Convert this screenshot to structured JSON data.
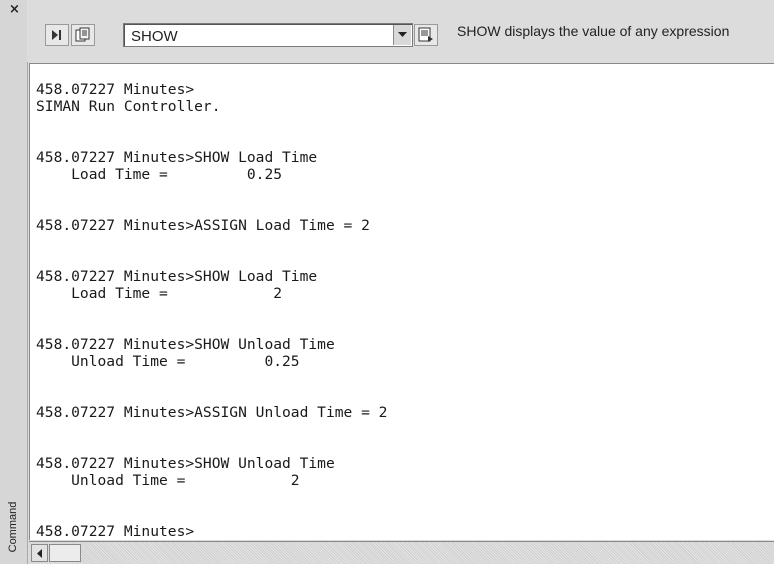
{
  "panel": {
    "title": "Command"
  },
  "toolbar": {
    "combo_value": "SHOW",
    "hint": "SHOW displays the value of any expression"
  },
  "console": {
    "lines": [
      "458.07227 Minutes>",
      "SIMAN Run Controller.",
      "",
      "",
      "458.07227 Minutes>SHOW Load Time",
      "    Load Time =         0.25",
      "",
      "",
      "458.07227 Minutes>ASSIGN Load Time = 2",
      "",
      "",
      "458.07227 Minutes>SHOW Load Time",
      "    Load Time =            2",
      "",
      "",
      "458.07227 Minutes>SHOW Unload Time",
      "    Unload Time =         0.25",
      "",
      "",
      "458.07227 Minutes>ASSIGN Unload Time = 2",
      "",
      "",
      "458.07227 Minutes>SHOW Unload Time",
      "    Unload Time =            2",
      "",
      "",
      "458.07227 Minutes>"
    ]
  }
}
